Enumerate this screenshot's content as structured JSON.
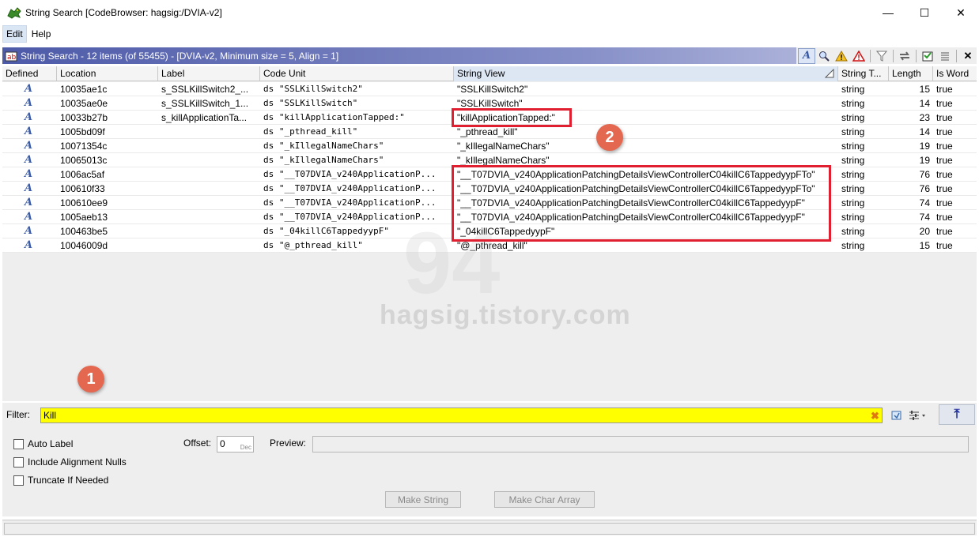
{
  "window": {
    "title": "String Search [CodeBrowser: hagsig:/DVIA-v2]",
    "minimize": "—",
    "maximize": "☐",
    "close": "✕"
  },
  "menu": {
    "items": [
      {
        "label": "Edit",
        "active": true
      },
      {
        "label": "Help",
        "active": false
      }
    ]
  },
  "panel": {
    "title": "String Search - 12 items (of 55455) - [DVIA-v2, Minimum size = 5, Align = 1]"
  },
  "table": {
    "headers": [
      "Defined",
      "Location",
      "Label",
      "Code Unit",
      "String View",
      "String T...",
      "Length",
      "Is Word"
    ],
    "sorted_column": "String View",
    "rows": [
      {
        "defined": "A",
        "location": "10035ae1c",
        "label": "s_SSLKillSwitch2_...",
        "code_unit": "ds \"SSLKillSwitch2\"",
        "string_view": "\"SSLKillSwitch2\"",
        "type": "string",
        "length": "15",
        "is_word": "true"
      },
      {
        "defined": "A",
        "location": "10035ae0e",
        "label": "s_SSLKillSwitch_1...",
        "code_unit": "ds \"SSLKillSwitch\"",
        "string_view": "\"SSLKillSwitch\"",
        "type": "string",
        "length": "14",
        "is_word": "true"
      },
      {
        "defined": "A",
        "location": "10033b27b",
        "label": "s_killApplicationTa...",
        "code_unit": "ds \"killApplicationTapped:\"",
        "string_view": "\"killApplicationTapped:\"",
        "type": "string",
        "length": "23",
        "is_word": "true"
      },
      {
        "defined": "A",
        "location": "1005bd09f",
        "label": "",
        "code_unit": "ds \"_pthread_kill\"",
        "string_view": "\"_pthread_kill\"",
        "type": "string",
        "length": "14",
        "is_word": "true"
      },
      {
        "defined": "A",
        "location": "10071354c",
        "label": "",
        "code_unit": "ds \"_kIllegalNameChars\"",
        "string_view": "\"_kIllegalNameChars\"",
        "type": "string",
        "length": "19",
        "is_word": "true"
      },
      {
        "defined": "A",
        "location": "10065013c",
        "label": "",
        "code_unit": "ds \"_kIllegalNameChars\"",
        "string_view": "\"_kIllegalNameChars\"",
        "type": "string",
        "length": "19",
        "is_word": "true"
      },
      {
        "defined": "A",
        "location": "1006ac5af",
        "label": "",
        "code_unit": "ds \"__T07DVIA_v240ApplicationP...",
        "string_view": "\"__T07DVIA_v240ApplicationPatchingDetailsViewControllerC04killC6TappedyypFTo\"",
        "type": "string",
        "length": "76",
        "is_word": "true"
      },
      {
        "defined": "A",
        "location": "100610f33",
        "label": "",
        "code_unit": "ds \"__T07DVIA_v240ApplicationP...",
        "string_view": "\"__T07DVIA_v240ApplicationPatchingDetailsViewControllerC04killC6TappedyypFTo\"",
        "type": "string",
        "length": "76",
        "is_word": "true"
      },
      {
        "defined": "A",
        "location": "100610ee9",
        "label": "",
        "code_unit": "ds \"__T07DVIA_v240ApplicationP...",
        "string_view": "\"__T07DVIA_v240ApplicationPatchingDetailsViewControllerC04killC6TappedyypF\"",
        "type": "string",
        "length": "74",
        "is_word": "true"
      },
      {
        "defined": "A",
        "location": "1005aeb13",
        "label": "",
        "code_unit": "ds \"__T07DVIA_v240ApplicationP...",
        "string_view": "\"__T07DVIA_v240ApplicationPatchingDetailsViewControllerC04killC6TappedyypF\"",
        "type": "string",
        "length": "74",
        "is_word": "true"
      },
      {
        "defined": "A",
        "location": "100463be5",
        "label": "",
        "code_unit": "ds \"_04killC6TappedyypF\"",
        "string_view": "\"_04killC6TappedyypF\"",
        "type": "string",
        "length": "20",
        "is_word": "true"
      },
      {
        "defined": "A",
        "location": "10046009d",
        "label": "",
        "code_unit": "ds \"@_pthread_kill\"",
        "string_view": "\"@_pthread_kill\"",
        "type": "string",
        "length": "15",
        "is_word": "true"
      }
    ]
  },
  "watermark": {
    "big": "94",
    "text": "hagsig.tistory.com"
  },
  "markers": {
    "one": "1",
    "two": "2"
  },
  "filter": {
    "label": "Filter:",
    "value": "Kill",
    "clear_icon": "clear-x-icon"
  },
  "options": {
    "auto_label": "Auto Label",
    "include_alignment_nulls": "Include Alignment Nulls",
    "truncate_if_needed": "Truncate If Needed",
    "offset_label": "Offset:",
    "offset_value": "0",
    "offset_unit": "Dec",
    "preview_label": "Preview:",
    "make_string": "Make String",
    "make_char_array": "Make Char Array"
  },
  "colors": {
    "highlight": "#e02030",
    "filter_bg": "#ffff00",
    "marker": "#e4674f",
    "panel_header": "#4d5aa8"
  }
}
